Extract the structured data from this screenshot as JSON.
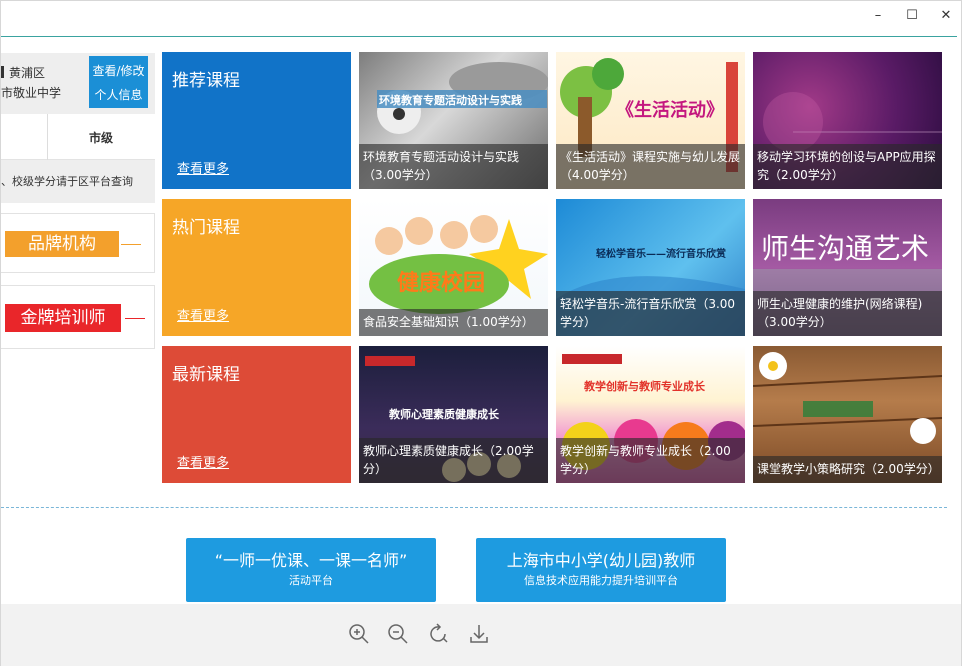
{
  "window": {
    "minimize": "–",
    "maximize": "☐",
    "close": "✕"
  },
  "profile": {
    "district": "黄浦区",
    "school": "市敬业中学",
    "edit_button_line1": "查看/修改",
    "edit_button_line2": "个人信息",
    "level": "市级",
    "note": "、校级学分请于区平台查询"
  },
  "brands": [
    {
      "label": "品牌机构",
      "color": "#f3a02c"
    },
    {
      "label": "金牌培训师",
      "color": "#e9262a"
    }
  ],
  "categories": [
    {
      "title": "推荐课程",
      "more": "查看更多",
      "color": "#1173c8"
    },
    {
      "title": "热门课程",
      "more": "查看更多",
      "color": "#f6a627"
    },
    {
      "title": "最新课程",
      "more": "查看更多",
      "color": "#dd4b37"
    }
  ],
  "courses": [
    {
      "caption": "环境教育专题活动设计与实践（3.00学分）",
      "art_text": "环境教育专题活动设计与实践"
    },
    {
      "caption": "《生活活动》课程实施与幼儿发展（4.00学分）",
      "art_text": "《生活活动》"
    },
    {
      "caption": "移动学习环境的创设与APP应用探究（2.00学分）",
      "art_text": ""
    },
    {
      "caption": "食品安全基础知识（1.00学分）",
      "art_text": "健康校园"
    },
    {
      "caption": "轻松学音乐-流行音乐欣赏（3.00学分）",
      "art_text": "轻松学音乐——流行音乐欣赏"
    },
    {
      "caption": "师生心理健康的维护(网络课程)（3.00学分）",
      "art_text": "师生沟通艺术"
    },
    {
      "caption": "教师心理素质健康成长（2.00学分）",
      "art_text": "教师心理素质健康成长"
    },
    {
      "caption": "教学创新与教师专业成长（2.00学分）",
      "art_text": "教学创新与教师专业成长"
    },
    {
      "caption": "课堂教学小策略研究（2.00学分）",
      "art_text": ""
    }
  ],
  "platforms": [
    {
      "line1": "“一师一优课、一课一名师”",
      "line2": "活动平台"
    },
    {
      "line1": "上海市中小学(幼儿园)教师",
      "line2": "信息技术应用能力提升培训平台"
    }
  ],
  "toolbar": {
    "zoom_in": "zoom-in-icon",
    "zoom_out": "zoom-out-icon",
    "rotate": "rotate-icon",
    "download": "download-icon"
  }
}
